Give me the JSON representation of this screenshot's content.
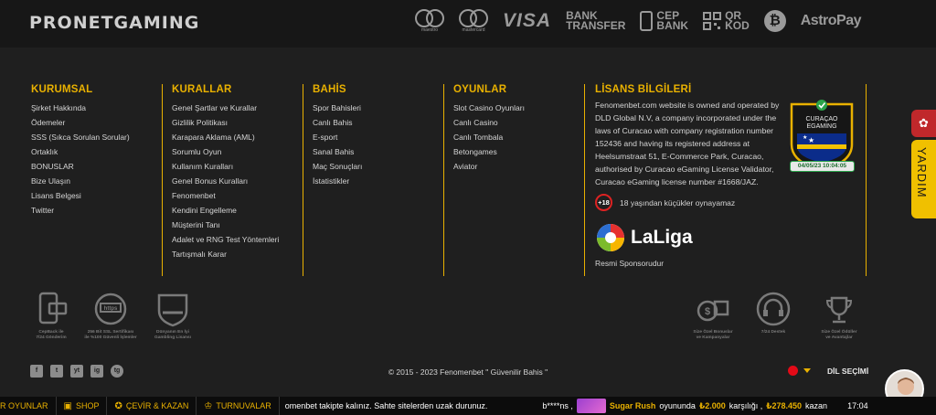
{
  "brand": {
    "logo": "PRONETGAMING"
  },
  "payments": [
    {
      "name": "maestro",
      "label": "maestro"
    },
    {
      "name": "mastercard",
      "label": "mastercard"
    },
    {
      "name": "visa",
      "label": "VISA"
    },
    {
      "name": "bank-transfer",
      "label1": "BANK",
      "label2": "TRANSFER"
    },
    {
      "name": "cep-bank",
      "label1": "CEP",
      "label2": "BANK"
    },
    {
      "name": "qr-kod",
      "label1": "QR",
      "label2": "KOD"
    },
    {
      "name": "bitcoin",
      "label": "₿"
    },
    {
      "name": "astropay",
      "label": "AstroPay"
    }
  ],
  "columns": {
    "kurumsal": {
      "title": "KURUMSAL",
      "items": [
        "Şirket Hakkında",
        "Ödemeler",
        "SSS (Sıkca Sorulan Sorular)",
        "Ortaklık",
        "BONUSLAR",
        "Bize Ulaşın",
        "Lisans Belgesi",
        "Twitter"
      ]
    },
    "kurallar": {
      "title": "KURALLAR",
      "items": [
        "Genel Şartlar ve Kurallar",
        "Gizlilik Politikası",
        "Karapara Aklama (AML)",
        "Sorumlu Oyun",
        "Kullanım Kuralları",
        "Genel Bonus Kuralları",
        "Fenomenbet",
        "Kendini Engelleme",
        "Müşterini Tanı",
        "Adalet ve RNG Test Yöntemleri",
        "Tartışmalı Karar"
      ]
    },
    "bahis": {
      "title": "BAHİS",
      "items": [
        "Spor Bahisleri",
        "Canlı Bahis",
        "E-sport",
        "Sanal Bahis",
        "Maç Sonuçları",
        "İstatistikler"
      ]
    },
    "oyunlar": {
      "title": "OYUNLAR",
      "items": [
        "Slot Casino Oyunları",
        "Canlı Casino",
        "Canlı Tombala",
        "Betongames",
        "Aviator"
      ]
    }
  },
  "license": {
    "title": "LİSANS BİLGİLERİ",
    "text": "Fenomenbet.com website is owned and operated by DLD Global N.V, a company incorporated under the laws of Curacao with company registration number 152436 and having its registered address at Heelsumstraat 51, E-Commerce Park, Curacao, authorised by Curacao eGaming License Validator, Curacao eGaming license number #1668/JAZ.",
    "badge_line1": "CURAÇAO",
    "badge_line2": "EGAMING",
    "badge_date": "04/05/23  10:04:05",
    "age_badge": "+18",
    "age_text": "18 yaşından küçükler oynayamaz",
    "laliga": "LaLiga",
    "sponsor": "Resmi Sponsorudur"
  },
  "features_left": [
    {
      "icon": "cashback-icon",
      "line1": "CepBack ile",
      "line2": "7/24 Gönderim"
    },
    {
      "icon": "ssl-icon",
      "line1": "256 Bit SSL Sertifikası",
      "line2": "ile %100 Güvenli İşlemler"
    },
    {
      "icon": "shield-icon",
      "line1": "Dünyanın En İyi",
      "line2": "Gambling Lisansı"
    }
  ],
  "features_right": [
    {
      "icon": "gift-icon",
      "line1": "Size Özel Bonuslar",
      "line2": "ve Kampanyalar"
    },
    {
      "icon": "headset-icon",
      "line1": "7/24 Destek",
      "line2": ""
    },
    {
      "icon": "trophy-icon",
      "line1": "Size Özel Ödüller",
      "line2": "ve Avantajlar"
    }
  ],
  "social": [
    "f",
    "t",
    "yt",
    "ig",
    "tg"
  ],
  "copyright": "© 2015 - 2023 Fenomenbet \" Güvenilir Bahis \"",
  "language": {
    "label": "DİL SEÇİMİ"
  },
  "side": {
    "help": "YARDIM"
  },
  "bottombar": {
    "items": [
      {
        "icon": "▶",
        "label": "R OYUNLAR"
      },
      {
        "icon": "🛒",
        "label": "SHOP"
      },
      {
        "icon": "✪",
        "label": "ÇEVİR & KAZAN"
      },
      {
        "icon": "🏆",
        "label": "TURNUVALAR"
      }
    ],
    "ticker_text": "omenbet takipte kalınız. Sahte sitelerden uzak durunuz.",
    "winner": "b****ns ,",
    "game": "Sugar Rush",
    "game_text": "oyununda",
    "bet": "₺2.000",
    "win_text": "karşılığı ,",
    "win": "₺278.450",
    "tail": "kazan",
    "time": "17:04"
  },
  "colors": {
    "accent": "#e9b100",
    "background": "#1f1f1f",
    "help": "#f0c000",
    "red": "#c0282b"
  }
}
